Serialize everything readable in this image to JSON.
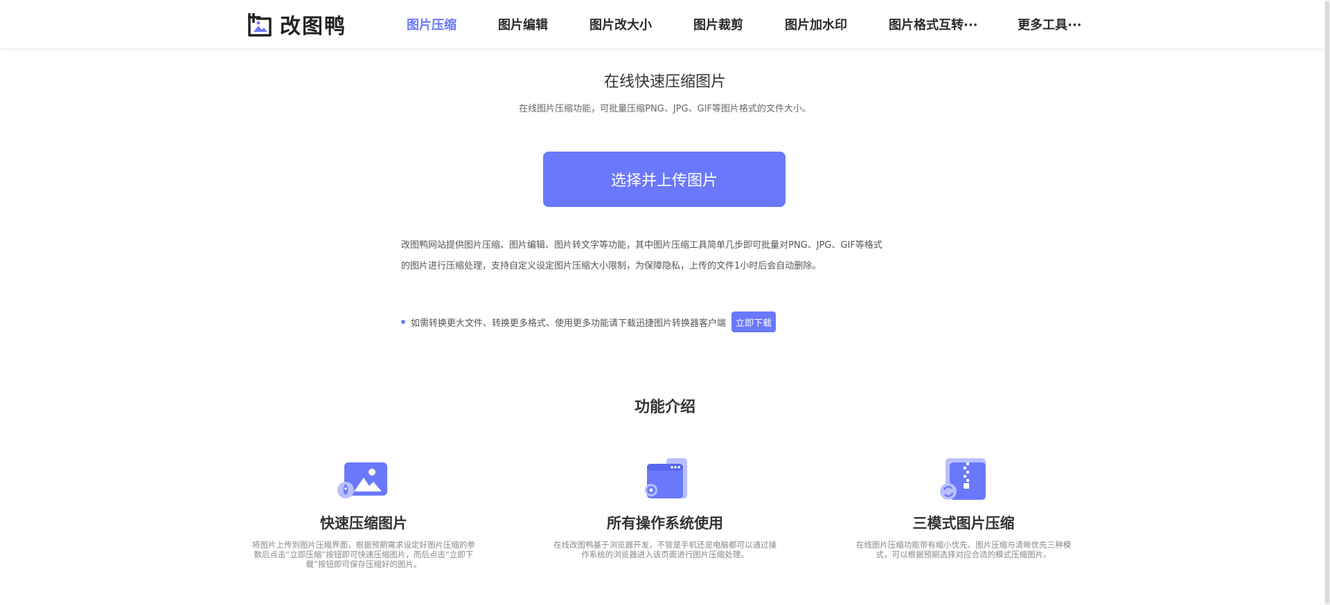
{
  "brand": {
    "logo_text": "改图鸭",
    "accent_color": "#6a78fb",
    "logo_icon": "image-frame-logo-icon"
  },
  "nav": {
    "items": [
      {
        "label": "图片压缩",
        "active": true
      },
      {
        "label": "图片编辑",
        "active": false
      },
      {
        "label": "图片改大小",
        "active": false
      },
      {
        "label": "图片裁剪",
        "active": false
      },
      {
        "label": "图片加水印",
        "active": false
      },
      {
        "label": "图片格式互转···",
        "active": false
      },
      {
        "label": "更多工具···",
        "active": false
      }
    ]
  },
  "hero": {
    "title": "在线快速压缩图片",
    "subtitle": "在线图片压缩功能，可批量压缩PNG、JPG、GIF等图片格式的文件大小。",
    "upload_label": "选择并上传图片"
  },
  "intro": {
    "line1": "改图鸭网站提供图片压缩、图片编辑、图片转文字等功能，其中图片压缩工具简单几步即可批量对PNG、JPG、GIF等格式",
    "line2": "的图片进行压缩处理，支持自定义设定图片压缩大小限制，为保障隐私，上传的文件1小时后会自动删除。"
  },
  "tip": {
    "text": "如需转换更大文件、转换更多格式、使用更多功能请下载迅捷图片转换器客户端",
    "button_label": "立即下载"
  },
  "features": {
    "section_title": "功能介绍",
    "items": [
      {
        "icon": "image-rocket-icon",
        "title": "快速压缩图片",
        "desc": "将图片上传到图片压缩界面，根据预期需求设定好图片压缩的参数后点击“立即压缩”按钮即可快速压缩图片，而后点击“立即下载”按钮即可保存压缩好的图片。"
      },
      {
        "icon": "browser-gear-icon",
        "title": "所有操作系统使用",
        "desc": "在线改图鸭基于浏览器开发，不管是手机还是电脑都可以通过操作系统的浏览器进入该页面进行图片压缩处理。"
      },
      {
        "icon": "zip-file-refresh-icon",
        "title": "三模式图片压缩",
        "desc": "在线图片压缩功能带有缩小优先、图片压缩与清晰优先三种模式，可以根据预期选择对应合适的模式压缩图片。"
      }
    ]
  }
}
